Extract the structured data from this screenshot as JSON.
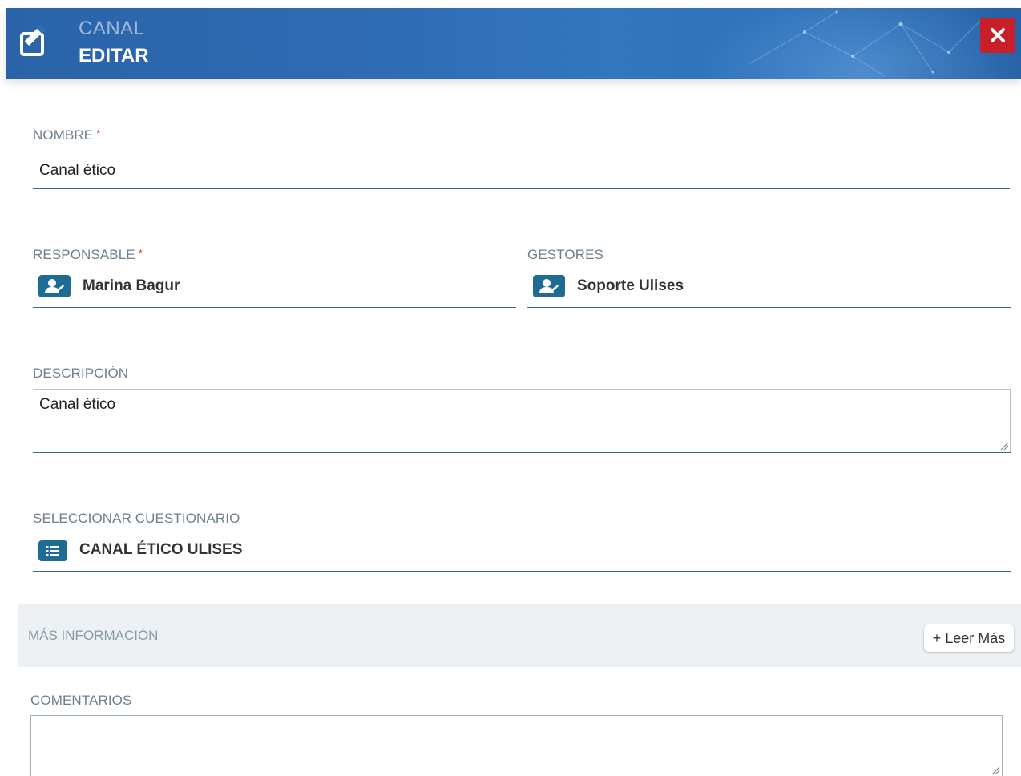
{
  "header": {
    "section": "CANAL",
    "mode": "EDITAR",
    "edit_icon": "edit-square-icon",
    "close_icon": "close-icon",
    "close_color": "#c8202a"
  },
  "form": {
    "nombre": {
      "label": "NOMBRE",
      "required_mark": "*",
      "value": "Canal ético"
    },
    "responsable": {
      "label": "RESPONSABLE",
      "required_mark": "*",
      "value": "Marina Bagur",
      "icon": "user-icon"
    },
    "gestores": {
      "label": "GESTORES",
      "value": "Soporte Ulises",
      "icon": "user-icon"
    },
    "descripcion": {
      "label": "DESCRIPCIÓN",
      "value": "Canal ético"
    },
    "cuestionario": {
      "label": "SELECCIONAR CUESTIONARIO",
      "value": "CANAL ÉTICO ULISES",
      "icon": "list-icon"
    },
    "mas_informacion": {
      "label": "MÁS INFORMACIÓN",
      "button": "+ Leer Más"
    },
    "comentarios": {
      "label": "COMENTARIOS",
      "value": ""
    }
  },
  "colors": {
    "accent": "#1e6b93",
    "header": "#2e6bb3",
    "required": "#d9332c"
  }
}
